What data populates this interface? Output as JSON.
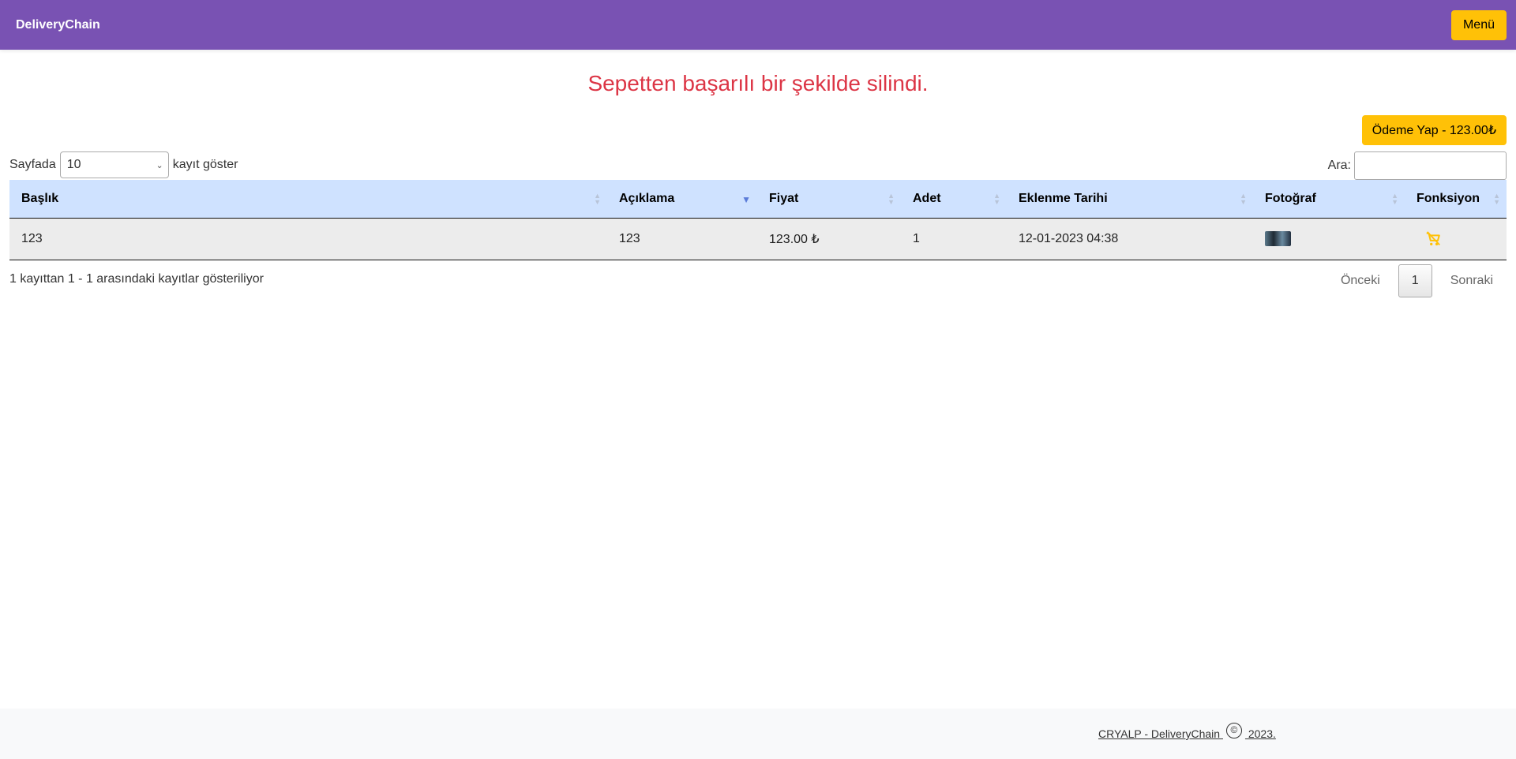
{
  "navbar": {
    "brand": "DeliveryChain",
    "menu_label": "Menü"
  },
  "alert": {
    "message": "Sepetten başarılı bir şekilde silindi."
  },
  "pay_button": {
    "label": "Ödeme Yap - 123.00₺"
  },
  "table_controls": {
    "length_prefix": "Sayfada",
    "length_value": "10",
    "length_suffix": "kayıt göster",
    "search_label": "Ara:",
    "search_value": ""
  },
  "table": {
    "headers": [
      "Başlık",
      "Açıklama",
      "Fiyat",
      "Adet",
      "Eklenme Tarihi",
      "Fotoğraf",
      "Fonksiyon"
    ],
    "rows": [
      {
        "title": "123",
        "description": "123",
        "price": "123.00 ₺",
        "quantity": "1",
        "date": "12-01-2023 04:38",
        "photo": "product-thumbnail",
        "action_icon": "remove-from-cart-icon"
      }
    ]
  },
  "pagination": {
    "info": "1 kayıttan 1 - 1 arasındaki kayıtlar gösteriliyor",
    "previous": "Önceki",
    "current": "1",
    "next": "Sonraki"
  },
  "footer": {
    "left_text": "CRYALP - DeliveryChain ",
    "symbol": "©",
    "right_text": " 2023."
  },
  "colors": {
    "navbar": "#7952b3",
    "accent": "#ffc107",
    "alert": "#dc3545",
    "table_header": "#cfe2ff"
  }
}
